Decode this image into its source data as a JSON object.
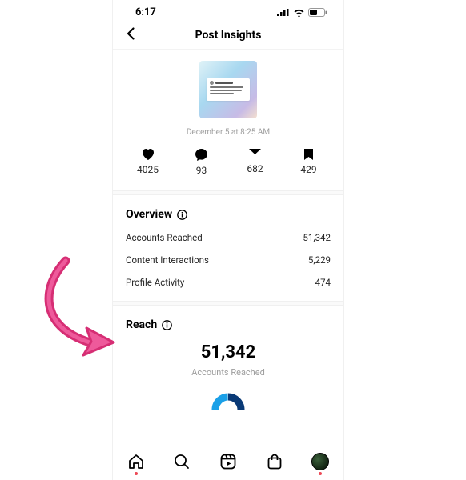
{
  "statusbar": {
    "time": "6:17"
  },
  "header": {
    "title": "Post Insights"
  },
  "post": {
    "date": "December 5 at 8:25 AM"
  },
  "engagement": {
    "likes": "4025",
    "comments": "93",
    "shares": "682",
    "saves": "429"
  },
  "overview": {
    "title": "Overview",
    "rows": [
      {
        "label": "Accounts Reached",
        "value": "51,342"
      },
      {
        "label": "Content Interactions",
        "value": "5,229"
      },
      {
        "label": "Profile Activity",
        "value": "474"
      }
    ]
  },
  "reach": {
    "title": "Reach",
    "value": "51,342",
    "label": "Accounts Reached"
  }
}
